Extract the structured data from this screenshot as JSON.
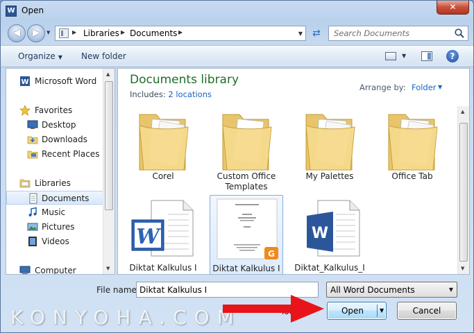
{
  "window": {
    "title": "Open",
    "app_icon_letter": "W",
    "close_glyph": "✕"
  },
  "navigation": {
    "back_glyph": "◀",
    "forward_glyph": "▶",
    "breadcrumb": [
      "Libraries",
      "Documents"
    ],
    "refresh_glyph": "⇄",
    "search_placeholder": "Search Documents"
  },
  "toolbar": {
    "organize_label": "Organize",
    "new_folder_label": "New folder",
    "help_glyph": "?"
  },
  "sidebar": {
    "items": [
      {
        "label": "Microsoft Word",
        "icon": "word-icon"
      },
      {
        "label": "Favorites",
        "icon": "star-icon"
      },
      {
        "label": "Desktop",
        "icon": "desktop-icon"
      },
      {
        "label": "Downloads",
        "icon": "downloads-icon"
      },
      {
        "label": "Recent Places",
        "icon": "recent-places-icon"
      },
      {
        "label": "Libraries",
        "icon": "libraries-icon"
      },
      {
        "label": "Documents",
        "icon": "documents-icon",
        "selected": true
      },
      {
        "label": "Music",
        "icon": "music-icon"
      },
      {
        "label": "Pictures",
        "icon": "pictures-icon"
      },
      {
        "label": "Videos",
        "icon": "videos-icon"
      },
      {
        "label": "Computer",
        "icon": "computer-icon"
      }
    ]
  },
  "content": {
    "title": "Documents library",
    "includes_label": "Includes:",
    "includes_link": "2 locations",
    "arrange_label": "Arrange by:",
    "arrange_value": "Folder",
    "items": [
      {
        "name": "Corel",
        "kind": "folder"
      },
      {
        "name": "Custom Office Templates",
        "kind": "folder"
      },
      {
        "name": "My Palettes",
        "kind": "folder"
      },
      {
        "name": "Office Tab",
        "kind": "folder"
      },
      {
        "name": "Diktat Kalkulus I",
        "kind": "word-doc-legacy"
      },
      {
        "name": "Diktat Kalkulus I",
        "kind": "document-preview",
        "selected": true
      },
      {
        "name": "Diktat_Kalkulus_I",
        "kind": "word-doc"
      }
    ]
  },
  "footer": {
    "file_name_label": "File name:",
    "file_name_value": "Diktat Kalkulus I",
    "file_type_value": "All Word Documents",
    "tools_label": "Tools",
    "open_label": "Open",
    "cancel_label": "Cancel"
  },
  "watermark": "KONYOHA.COM",
  "colors": {
    "title_green": "#1f6d2a",
    "link_blue": "#1565c0",
    "folder_yellow": "#f3d98a",
    "word_blue": "#2b579a",
    "arrow_red": "#e8141a"
  }
}
